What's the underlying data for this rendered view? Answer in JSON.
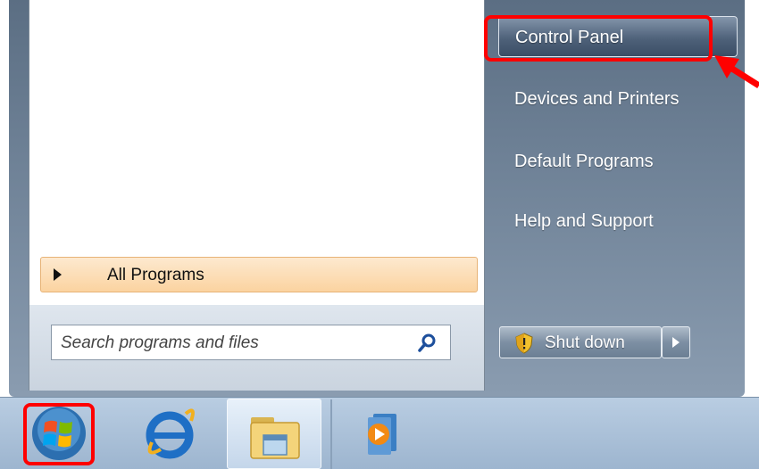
{
  "start_menu": {
    "all_programs_label": "All Programs",
    "search_placeholder": "Search programs and files",
    "right_items": [
      {
        "label": "Control Panel"
      },
      {
        "label": "Devices and Printers"
      },
      {
        "label": "Default Programs"
      },
      {
        "label": "Help and Support"
      }
    ],
    "shutdown_label": "Shut down"
  },
  "taskbar": {
    "items": [
      {
        "icon": "windows-start-orb-icon"
      },
      {
        "icon": "internet-explorer-icon"
      },
      {
        "icon": "windows-explorer-folder-icon"
      },
      {
        "icon": "windows-media-player-icon"
      }
    ]
  },
  "annotation": {
    "color": "#ff0000"
  }
}
